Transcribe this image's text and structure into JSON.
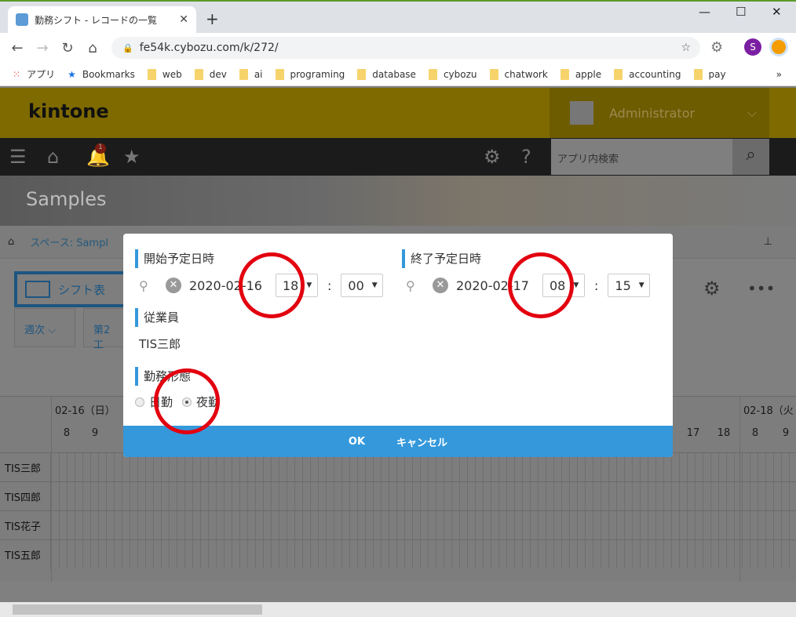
{
  "browser": {
    "tab_title": "勤務シフト - レコードの一覧",
    "url": "fe54k.cybozu.com/k/272/",
    "profile_initial": "S",
    "bookmarks": [
      "アプリ",
      "Bookmarks",
      "web",
      "dev",
      "ai",
      "programing",
      "database",
      "cybozu",
      "chatwork",
      "apple",
      "accounting",
      "pay"
    ]
  },
  "kintone": {
    "logo": "kintone",
    "user": "Administrator",
    "notification_count": "1",
    "search_placeholder": "アプリ内検索",
    "space_title": "Samples",
    "breadcrumb": "スペース: Sampl",
    "view_name": "シフト表",
    "filter_period": "週次",
    "filter_group": "第2工"
  },
  "grid": {
    "days": [
      "02-16（日）",
      "02-18（火"
    ],
    "hours_day1": [
      "8",
      "9"
    ],
    "hours_day2": [
      "17",
      "18"
    ],
    "hours_day3": [
      "8",
      "9"
    ],
    "employees": [
      "TIS三郎",
      "TIS四郎",
      "TIS花子",
      "TIS五郎"
    ]
  },
  "dialog": {
    "start": {
      "label": "開始予定日時",
      "date": "2020-02-16",
      "hour": "18",
      "minute": "00"
    },
    "end": {
      "label": "終了予定日時",
      "date": "2020-02-17",
      "hour": "08",
      "minute": "15"
    },
    "employee": {
      "label": "従業員",
      "value": "TIS三郎"
    },
    "shift_type": {
      "label": "勤務形態",
      "options": [
        "日勤",
        "夜勤"
      ],
      "selected": "夜勤"
    },
    "ok": "OK",
    "cancel": "キャンセル"
  },
  "colors": {
    "accent": "#3498db",
    "annotation": "#e3000f",
    "header": "#fcc800"
  }
}
